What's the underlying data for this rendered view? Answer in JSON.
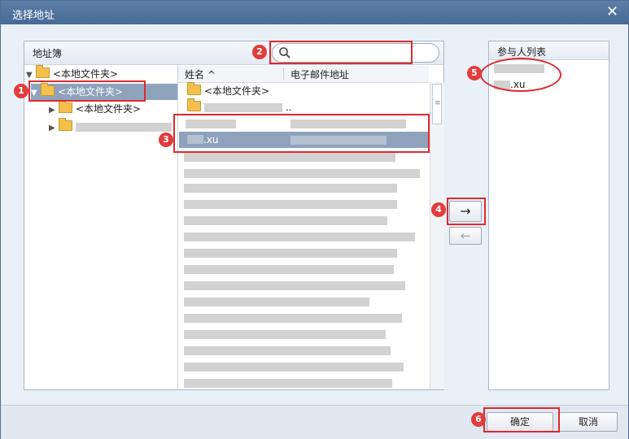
{
  "window": {
    "title": "选择地址",
    "close_icon": "close-icon"
  },
  "address_book": {
    "header": "地址簿",
    "tree": [
      {
        "label": "<本地文件夹>",
        "expanded": true
      },
      {
        "label": "<本地文件夹>",
        "expanded": true,
        "selected": true
      },
      {
        "label": "<本地文件夹>",
        "expanded": false
      },
      {
        "label": "",
        "expanded": false,
        "obscured": true
      }
    ]
  },
  "search": {
    "placeholder": "",
    "value": ""
  },
  "contacts": {
    "columns": {
      "name": "姓名 ^",
      "email": "电子邮件地址"
    },
    "rows": [
      {
        "name": "<本地文件夹>",
        "type": "folder"
      },
      {
        "name": "",
        "type": "folder",
        "obscured": true
      },
      {
        "name": "",
        "email": "",
        "obscured": true
      },
      {
        "name": ".xu",
        "email": "",
        "selected": true
      },
      {
        "obscured": true
      },
      {
        "obscured": true
      },
      {
        "obscured": true
      },
      {
        "obscured": true
      },
      {
        "obscured": true
      },
      {
        "obscured": true
      },
      {
        "obscured": true
      },
      {
        "obscured": true
      },
      {
        "obscured": true
      },
      {
        "obscured": true
      },
      {
        "obscured": true
      },
      {
        "obscured": true
      },
      {
        "obscured": true
      },
      {
        "obscured": true
      },
      {
        "obscured": true
      }
    ]
  },
  "transfer": {
    "add_label": "→",
    "remove_label": "←"
  },
  "participants": {
    "header": "参与人列表",
    "items": [
      {
        "name": "",
        "obscured": true
      },
      {
        "name": ".xu"
      }
    ]
  },
  "footer": {
    "ok_label": "确定",
    "cancel_label": "取消"
  },
  "annotations": [
    "1",
    "2",
    "3",
    "4",
    "5",
    "6"
  ],
  "colors": {
    "title_bar": "#4f729d",
    "selection": "#8ea3bb",
    "annotation": "#e0292e"
  }
}
